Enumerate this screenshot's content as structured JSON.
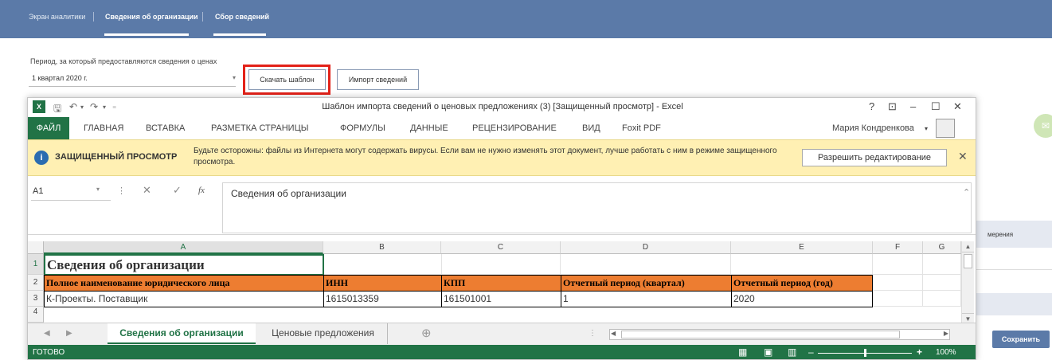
{
  "nav": {
    "items": [
      {
        "label": "Экран аналитики",
        "active": false
      },
      {
        "label": "Сведения об организации",
        "active": true
      },
      {
        "label": "Сбор сведений",
        "active": true
      }
    ]
  },
  "period": {
    "label": "Период, за который предоставляются сведения о ценах",
    "value": "1 квартал 2020 г."
  },
  "buttons": {
    "download_template": "Скачать шаблон",
    "import": "Импорт сведений",
    "save": "Сохранить"
  },
  "background": {
    "measure_label": "мерения"
  },
  "excel": {
    "title": "Шаблон импорта сведений о ценовых предложениях (3)  [Защищенный просмотр] - Excel",
    "window_controls": [
      "?",
      "⊡",
      "–",
      "☐",
      "✕"
    ],
    "ribbon_tabs": [
      "ФАЙЛ",
      "ГЛАВНАЯ",
      "ВСТАВКА",
      "РАЗМЕТКА СТРАНИЦЫ",
      "ФОРМУЛЫ",
      "ДАННЫЕ",
      "РЕЦЕНЗИРОВАНИЕ",
      "ВИД",
      "Foxit PDF"
    ],
    "user": "Мария Кондренкова",
    "protected_view": {
      "title": "ЗАЩИЩЕННЫЙ ПРОСМОТР",
      "message": "Будьте осторожны: файлы из Интернета могут содержать вирусы. Если вам не нужно изменять этот документ, лучше работать с ним в режиме защищенного просмотра.",
      "button": "Разрешить редактирование"
    },
    "name_box": "A1",
    "formula": "Сведения об организации",
    "columns": [
      "A",
      "B",
      "C",
      "D",
      "E",
      "F",
      "G"
    ],
    "rows": [
      "1",
      "2",
      "3",
      "4"
    ],
    "cells": {
      "a1": "Сведения об организации",
      "headers": [
        "Полное наименование юридического лица",
        "ИНН",
        "КПП",
        "Отчетный период (квартал)",
        "Отчетный период (год)"
      ],
      "row3": [
        "К-Проекты. Поставщик",
        "1615013359",
        "161501001",
        "1",
        "2020"
      ]
    },
    "sheet_tabs": [
      "Сведения об организации",
      "Ценовые предложения"
    ],
    "status": "ГОТОВО",
    "zoom": "100%"
  }
}
